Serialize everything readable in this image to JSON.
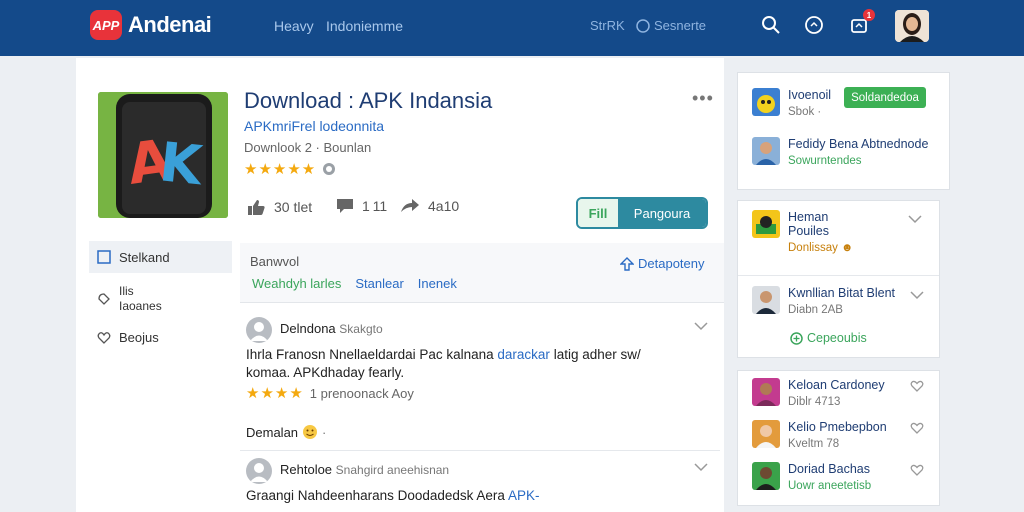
{
  "header": {
    "logo_badge": "APP",
    "logo_text": "Andenai",
    "nav": [
      "Heavy",
      "Indoniemme"
    ],
    "right_links": [
      "StrRK",
      "Sesnerte"
    ],
    "notif_count": "1"
  },
  "app": {
    "title": "Download : APK Indansia",
    "subtitle": "APKmriFrel lodeonnita",
    "meta": "Downlook 2 · Bounlan",
    "stars": "★★★★★",
    "likes": "30 tlet",
    "comments": "1 11",
    "shares": "4a10",
    "button_left": "Fill",
    "button_right": "Pangoura"
  },
  "sidenav": [
    {
      "label": "Stelkand"
    },
    {
      "label": "Ilis\nIaoanes"
    },
    {
      "label": "Beojus"
    }
  ],
  "filters": {
    "label": "Banwvol",
    "tabs": [
      {
        "label": "Weahdyh larles",
        "color": "#3ba55c"
      },
      {
        "label": "Stanlear",
        "color": "#2a6bc4"
      },
      {
        "label": "Inenek",
        "color": "#2a6bc4"
      }
    ],
    "right": "Detapoteny"
  },
  "reviews": [
    {
      "name": "Delndona",
      "handle": "Skakgto",
      "text_a": "Ihrla  Franosn Nnellaeldardai Pac kalnana ",
      "text_hl": "darackar",
      "text_b": " latig adher sw/ komaa. APKdhaday fearly.",
      "stars": "★★★★",
      "rating_note": "1 prenoonack Aoy",
      "reaction": "Demalan"
    },
    {
      "name": "Rehtoloe",
      "handle": "Snahgird aneehisnan",
      "text_a": "Graangi Nahdeenharans Doodadedsk Aera ",
      "text_hl": "APK-",
      "text_b": ""
    }
  ],
  "sidebar": {
    "card1": [
      {
        "name": "Ivoenoil",
        "sub": "Sbok ·",
        "pill": "Soldandedoa"
      },
      {
        "name": "Fedidy Bena Abtnednode",
        "sub": "Sowurntendes"
      }
    ],
    "card2": [
      {
        "name": "Heman\nPouiles",
        "sub": "Donlissay"
      },
      {
        "name": "Kwnllian Bitat Blent",
        "sub": "Diabn 2AB"
      },
      {
        "name": "",
        "sub": "",
        "link": "Cepeoubis"
      }
    ],
    "card3": [
      {
        "name": "Keloan Cardoney",
        "sub": "Diblr 4713"
      },
      {
        "name": "Kelio Pmebepbon",
        "sub": "Kveltm 78"
      },
      {
        "name": "Doriad Bachas",
        "sub": "Uowr aneetetisb"
      }
    ]
  },
  "colors": {
    "topbar": "#144a8a",
    "accent": "#2d8aa0",
    "green": "#3cb054",
    "star": "#f4a90f"
  }
}
